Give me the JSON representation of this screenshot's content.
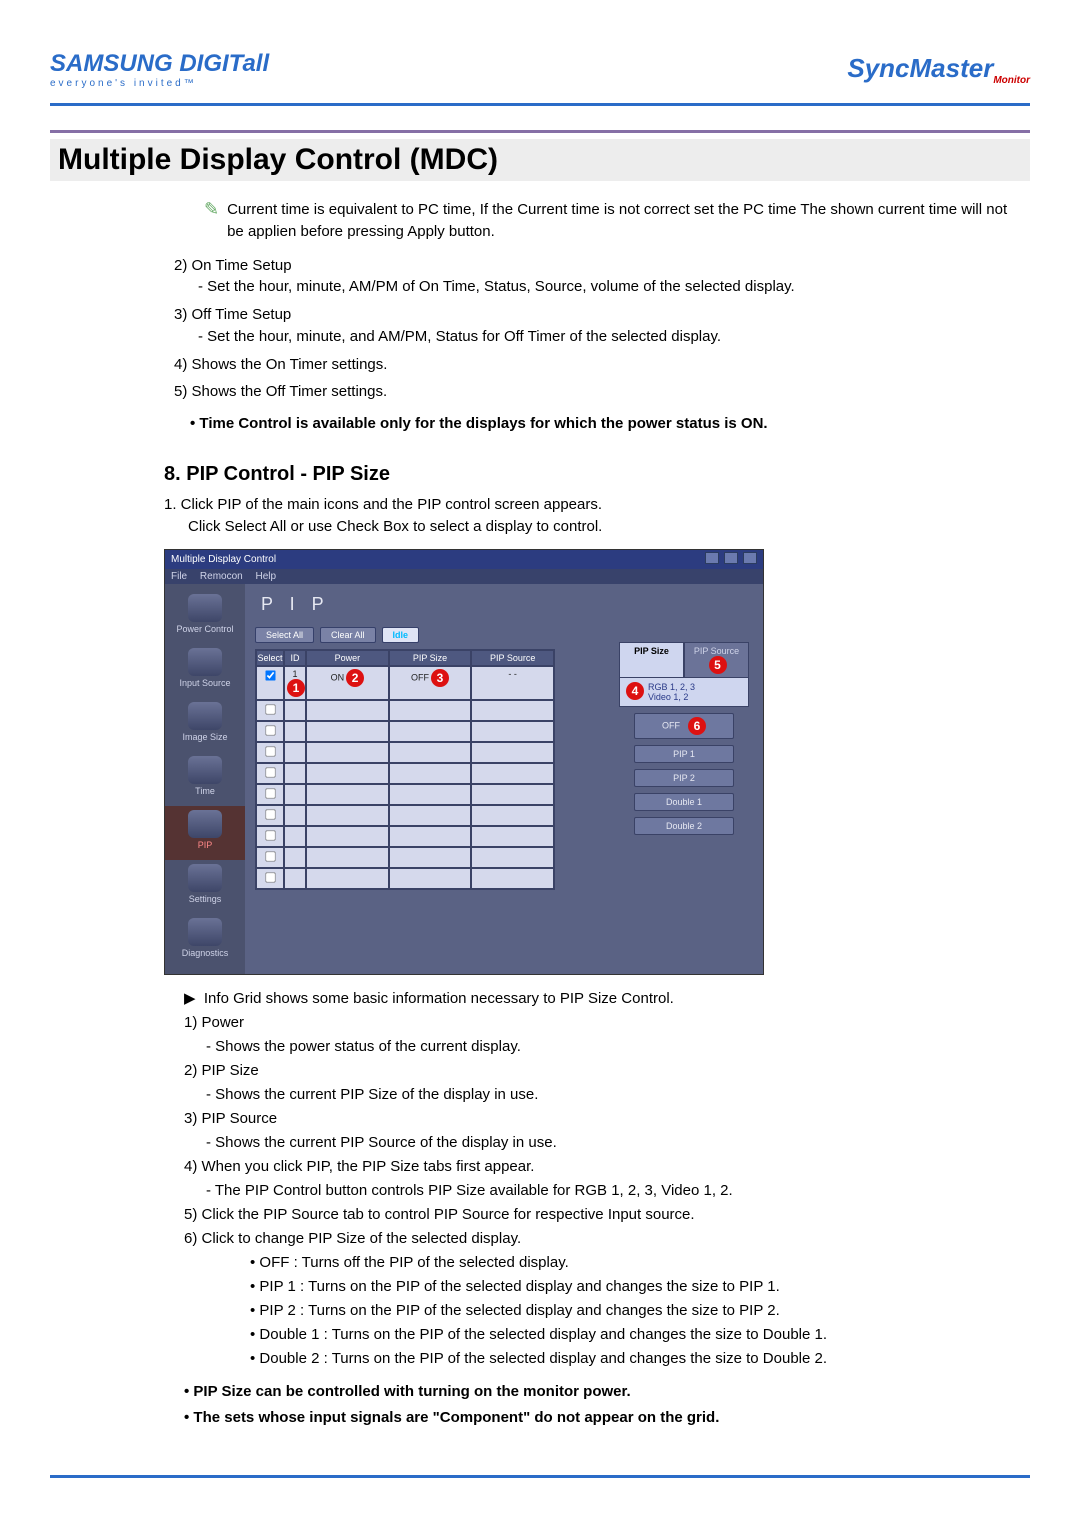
{
  "header": {
    "brand": "SAMSUNG DIGITall",
    "tagline": "everyone's invited™",
    "right": "SyncMaster",
    "right_sub": "Monitor"
  },
  "title": "Multiple Display Control (MDC)",
  "intro_note": "Current time is equivalent to PC time, If the Current time is not correct set the PC time The shown current time will not be applien before pressing Apply button.",
  "time_items": {
    "i2_label": "2) On Time Setup",
    "i2_sub": "- Set the hour, minute, AM/PM of On Time, Status, Source, volume of the selected display.",
    "i3_label": "3) Off Time Setup",
    "i3_sub": "- Set the hour, minute, and AM/PM, Status for Off Timer of the selected display.",
    "i4": "4) Shows the On Timer settings.",
    "i5": "5) Shows the Off Timer settings."
  },
  "time_bold_note": "Time Control is available only for the displays for which the power status is ON.",
  "section8_title": "8. PIP Control - PIP Size",
  "section8_intro_a": "1.  Click PIP of the main icons and the PIP control screen appears.",
  "section8_intro_b": "Click Select All or use Check Box to select a display to control.",
  "app": {
    "title": "Multiple Display Control",
    "menu": {
      "file": "File",
      "remocon": "Remocon",
      "help": "Help"
    },
    "sidebar": {
      "power": "Power Control",
      "input": "Input Source",
      "image": "Image Size",
      "time": "Time",
      "pip": "PIP",
      "settings": "Settings",
      "diag": "Diagnostics"
    },
    "heading": "P I P",
    "toolbar": {
      "select_all": "Select All",
      "clear_all": "Clear All",
      "idle": "Idle"
    },
    "grid_hdr": {
      "select": "Select",
      "id": "ID",
      "power": "Power",
      "pipsize": "PIP Size",
      "pipsource": "PIP Source"
    },
    "grid_row1": {
      "id": "1",
      "power": "ON",
      "pipsize": "OFF",
      "pipsource": "- -"
    },
    "right": {
      "tab_size": "PIP Size",
      "tab_source": "PIP Source",
      "sub": "RGB 1, 2, 3\nVideo 1, 2",
      "b_off": "OFF",
      "b_p1": "PIP 1",
      "b_p2": "PIP 2",
      "b_d1": "Double 1",
      "b_d2": "Double 2"
    },
    "markers": {
      "m1": "1",
      "m2": "2",
      "m3": "3",
      "m4": "4",
      "m5": "5",
      "m6": "6"
    }
  },
  "info": {
    "lead_arrow": "▶",
    "lead": "Info Grid shows some basic information necessary to PIP Size Control.",
    "n1": "1)  Power",
    "n1s": "- Shows the power status of the current display.",
    "n2": "2)  PIP Size",
    "n2s": "- Shows the current PIP Size of the display in use.",
    "n3": "3)  PIP Source",
    "n3s": "- Shows the current PIP Source of the display in use.",
    "n4": "4)  When you click PIP, the PIP Size tabs first appear.",
    "n4s": "- The PIP Control button controls PIP Size available for RGB 1, 2, 3, Video 1, 2.",
    "n5": "5)  Click the PIP Source tab to control PIP Source for respective Input source.",
    "n6": "6)  Click to change PIP Size of the selected display.",
    "n6a": "• OFF : Turns off the PIP of the selected display.",
    "n6b": "• PIP 1 : Turns on the PIP of the selected display and changes the size to PIP 1.",
    "n6c": "• PIP 2 : Turns on the PIP of the selected display and changes the size to PIP 2.",
    "n6d": "• Double 1 : Turns on the PIP of the selected display and changes the size to Double 1.",
    "n6e": "• Double 2 : Turns on the PIP of the selected display and changes the size to Double 2.",
    "bold1": "PIP Size can be controlled with turning on the monitor power.",
    "bold2": "The sets whose input signals are \"Component\" do not appear on the grid."
  }
}
